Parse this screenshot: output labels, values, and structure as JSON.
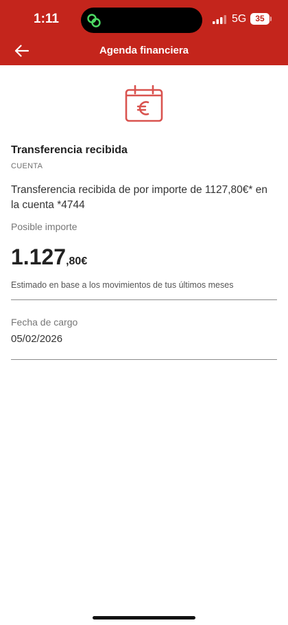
{
  "status_bar": {
    "time": "1:11",
    "network": "5G",
    "battery": "35"
  },
  "header": {
    "title": "Agenda financiera",
    "back_icon": "arrow-left-icon",
    "background_color": "#c4251c"
  },
  "event": {
    "icon": "calendar-euro-icon",
    "title": "Transferencia recibida",
    "category": "CUENTA",
    "description": "Transferencia recibida de  por importe de 1127,80€* en la cuenta *4744",
    "amount_label": "Posible importe",
    "amount_integer": "1.127",
    "amount_decimal": ",80€",
    "estimate_note": "Estimado en base a los movimientos de tus últimos meses",
    "charge_date_label": "Fecha de cargo",
    "charge_date": "05/02/2026"
  }
}
